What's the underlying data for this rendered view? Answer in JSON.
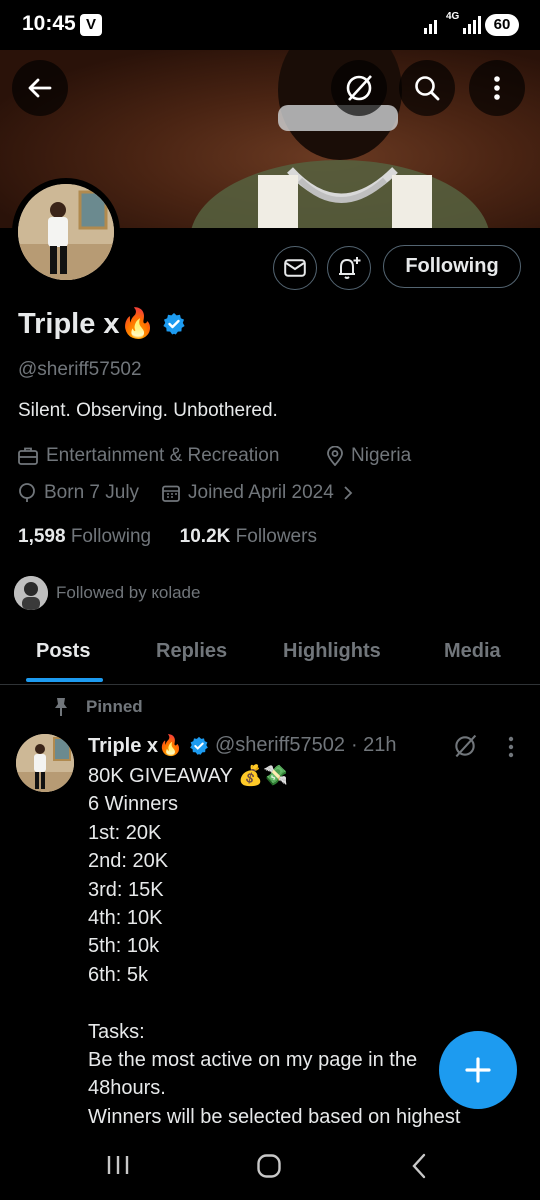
{
  "status_bar": {
    "time": "10:45",
    "app_badge": "V",
    "network": "4G",
    "battery": "60"
  },
  "profile": {
    "name": "Triple x🔥",
    "handle": "@sheriff57502",
    "bio": "Silent. Observing. Unbothered.",
    "category": "Entertainment & Recreation",
    "location": "Nigeria",
    "birthday": "Born 7 July",
    "joined": "Joined April 2024",
    "following_count": "1,598",
    "following_label": "Following",
    "followers_count": "10.2K",
    "followers_label": "Followers",
    "followed_by": "Followed by кolade",
    "follow_button": "Following"
  },
  "tabs": [
    {
      "label": "Posts"
    },
    {
      "label": "Replies"
    },
    {
      "label": "Highlights"
    },
    {
      "label": "Media"
    }
  ],
  "post": {
    "pinned_label": "Pinned",
    "name": "Triple x🔥",
    "handle": "@sheriff57502",
    "time": "· 21h",
    "text": "80K GIVEAWAY 💰💸\n6 Winners\n1st: 20K\n2nd: 20K\n3rd: 15K\n4th: 10K\n5th: 10k\n6th: 5k\n\nTasks:\nBe the most active on my page in the\n48hours.\nWinners will be selected based on highest"
  },
  "colors": {
    "accent": "#1d9bf0",
    "background": "#000000",
    "muted": "#71767b",
    "text": "#e7e9ea"
  },
  "icons": {
    "back": "arrow-left-icon",
    "grok": "grok-icon",
    "search": "search-icon",
    "more": "more-vertical-icon",
    "message": "envelope-icon",
    "notify": "bell-plus-icon",
    "verified": "verified-badge-icon",
    "category": "briefcase-icon",
    "location": "location-pin-icon",
    "birthday": "balloon-icon",
    "joined": "calendar-icon",
    "pin": "pin-icon",
    "compose": "plus-icon"
  }
}
